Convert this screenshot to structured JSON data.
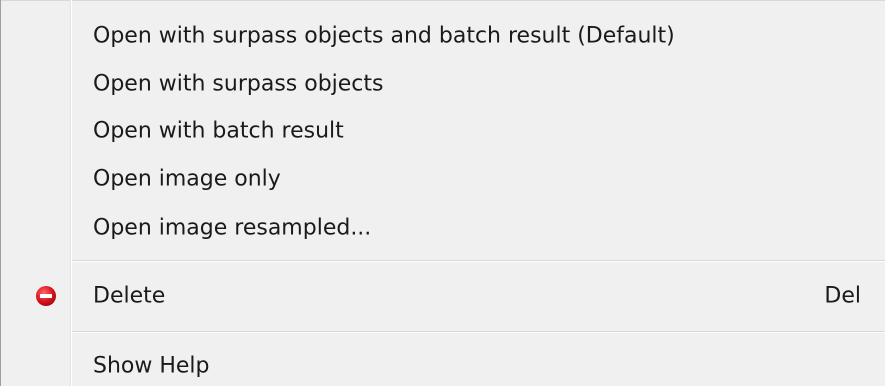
{
  "menu": {
    "items": [
      {
        "label": "Open with surpass objects and batch result (Default)"
      },
      {
        "label": "Open with surpass objects"
      },
      {
        "label": "Open with batch result"
      },
      {
        "label": "Open image only"
      },
      {
        "label": "Open image resampled..."
      },
      {
        "label": "Delete",
        "shortcut": "Del",
        "icon": "delete-icon"
      },
      {
        "label": "Show Help"
      }
    ],
    "colors": {
      "background": "#f0f0f0",
      "text": "#1a1a1a",
      "delete_icon": "#d9141d"
    }
  }
}
